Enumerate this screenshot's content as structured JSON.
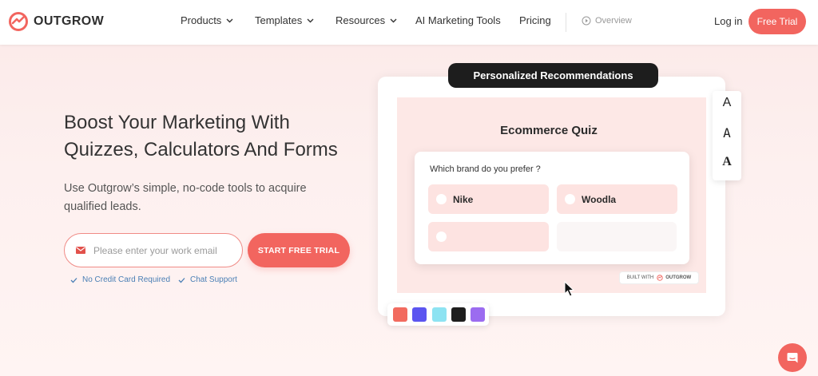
{
  "brand": {
    "name": "OUTGROW",
    "color": "#f2655f"
  },
  "nav": {
    "items": [
      {
        "label": "Products",
        "dropdown": true
      },
      {
        "label": "Templates",
        "dropdown": true
      },
      {
        "label": "Resources",
        "dropdown": true
      },
      {
        "label": "AI Marketing Tools",
        "dropdown": false
      },
      {
        "label": "Pricing",
        "dropdown": false
      }
    ],
    "overview_label": "Overview",
    "login_label": "Log in",
    "free_trial_label": "Free Trial"
  },
  "hero": {
    "headline_line1": "Boost Your Marketing With",
    "headline_line2": "Quizzes, Calculators And Forms",
    "subtext": "Use Outgrow’s simple, no-code tools to acquire qualified leads.",
    "email_placeholder": "Please enter your work email",
    "email_value": "",
    "cta_label": "START FREE TRIAL",
    "perks": [
      "No Credit Card Required",
      "Chat Support"
    ]
  },
  "mockup": {
    "pill_label": "Personalized Recommendations",
    "quiz_title": "Ecommerce Quiz",
    "question": "Which brand do you prefer ?",
    "options": [
      "Nike",
      "Woodla",
      ""
    ],
    "built_with_prefix": "BUILT WITH",
    "built_with_brand": "OUTGROW",
    "font_options": [
      "A",
      "A",
      "A"
    ],
    "palette_colors": [
      "#f26b5f",
      "#5b55f0",
      "#8de3f2",
      "#1e1e1e",
      "#9b6cf0"
    ]
  },
  "icons": {
    "logo": "outgrow-logo-icon",
    "dropdown": "chevron-down-icon",
    "overview": "play-circle-icon",
    "email": "mail-icon",
    "perk": "check-icon",
    "cursor": "mouse-pointer-icon",
    "chat": "chat-bubble-icon"
  }
}
